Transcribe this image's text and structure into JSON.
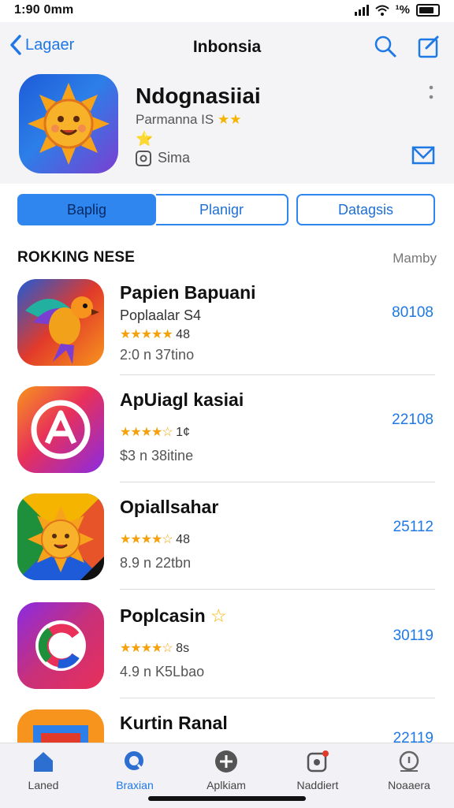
{
  "status": {
    "time": "1:90 0mm",
    "carrier": "ᯤ.т",
    "battery_text": "¹%"
  },
  "nav": {
    "back_label": "Lagaer",
    "title": "Inbonsia"
  },
  "hero": {
    "name": "Ndognasiiai",
    "subtitle": "Parmanna IS",
    "subtitle_stars": "★★",
    "badge": "⭐",
    "language": "Sima"
  },
  "tabs": [
    {
      "label": "Baplig",
      "active": true
    },
    {
      "label": "Planigr",
      "active": false
    },
    {
      "label": "Datagsis",
      "active": false
    }
  ],
  "section": {
    "heading": "ROKKING NESE",
    "more": "Mamby"
  },
  "apps": [
    {
      "name": "Papien Bapuani",
      "line2": "Poplaalar S4",
      "stars": "★★★★★",
      "rating": "48",
      "meta": "2:0 n 37tino",
      "price": "80108"
    },
    {
      "name": "ApUiagl kasiai",
      "line2": "",
      "stars": "★★★★☆",
      "rating": "1¢",
      "meta": "$3 n 38itine",
      "price": "22108"
    },
    {
      "name": "Opiallsahar",
      "line2": "",
      "stars": "★★★★☆",
      "rating": "48",
      "meta": "8.9 n 22tbn",
      "price": "25112"
    },
    {
      "name": "Poplcasin",
      "name_star": "☆",
      "line2": "",
      "stars": "★★★★☆",
      "rating": "8s",
      "meta": "4.9 n K5Lbao",
      "price": "30119"
    },
    {
      "name": "Kurtin Ranal",
      "line2": "",
      "stars": "",
      "rating": "",
      "meta": "",
      "price": "22119"
    }
  ],
  "tabbar": [
    {
      "label": "Laned",
      "icon": "home-icon",
      "active": false
    },
    {
      "label": "Braxian",
      "icon": "search-icon",
      "active": true
    },
    {
      "label": "Aplkiam",
      "icon": "plus-icon",
      "active": false
    },
    {
      "label": "Naddiert",
      "icon": "notification-icon",
      "active": false
    },
    {
      "label": "Noaaera",
      "icon": "info-icon",
      "active": false
    }
  ],
  "colors": {
    "accent": "#1e78e6",
    "star": "#f4b400"
  }
}
